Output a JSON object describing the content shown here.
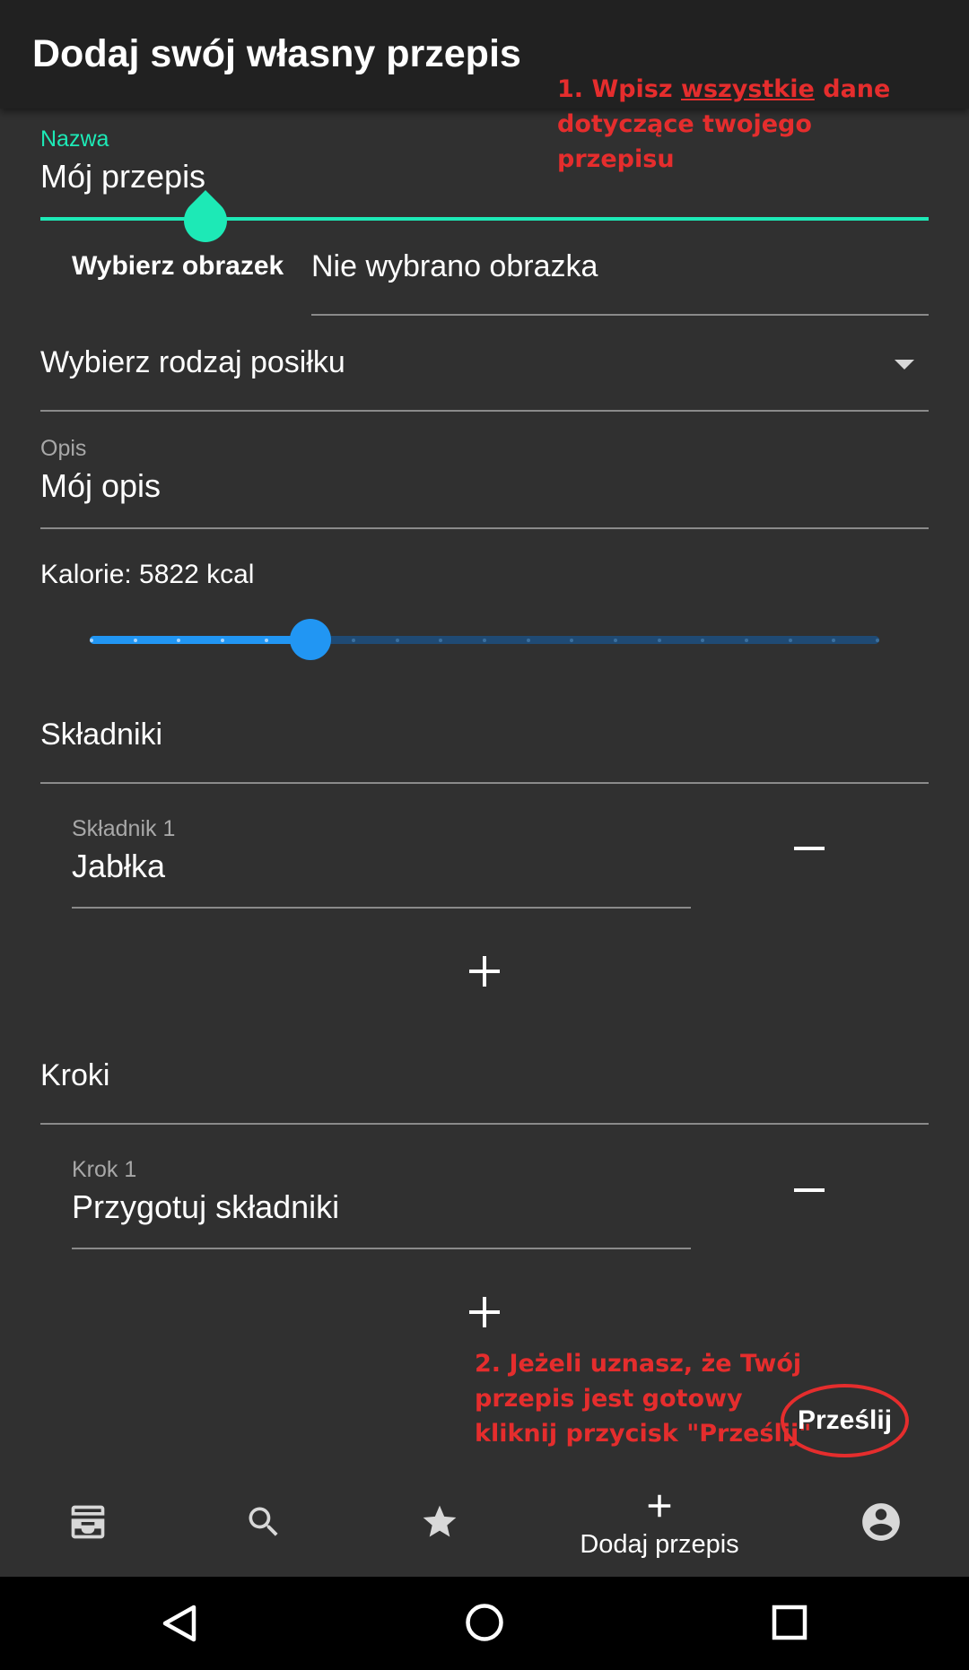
{
  "appbar": {
    "title": "Dodaj swój własny przepis"
  },
  "annotations": {
    "note1_prefix": "1. Wpisz ",
    "note1_emphasis": "wszystkie",
    "note1_suffix_line1": " dane",
    "note1_line2": "dotyczące twojego",
    "note1_line3": "przepisu",
    "note2_line1": "2. Jeżeli uznasz, że Twój",
    "note2_line2": "przepis jest gotowy",
    "note2_line3": "kliknij przycisk \"Prześlij\""
  },
  "name_field": {
    "label": "Nazwa",
    "value": "Mój przepis"
  },
  "image_picker": {
    "button_label": "Wybierz obrazek",
    "status": "Nie wybrano obrazka"
  },
  "meal_type": {
    "placeholder": "Wybierz rodzaj posiłku"
  },
  "description_field": {
    "label": "Opis",
    "value": "Mój opis"
  },
  "calories": {
    "label": "Kalorie: 5822 kcal",
    "slider_fraction": 0.28,
    "steps": 19,
    "active_color": "#2196f3",
    "inactive_color": "#1f4a74"
  },
  "ingredients": {
    "title": "Składniki",
    "items": [
      {
        "label": "Składnik 1",
        "value": "Jabłka"
      }
    ]
  },
  "steps": {
    "title": "Kroki",
    "items": [
      {
        "label": "Krok 1",
        "value": "Przygotuj składniki"
      }
    ]
  },
  "submit": {
    "label": "Prześlij"
  },
  "bottom_nav": {
    "items": [
      {
        "icon": "inbox-icon"
      },
      {
        "icon": "search-icon"
      },
      {
        "icon": "star-icon"
      },
      {
        "icon": "plus-icon",
        "label": "Dodaj przepis",
        "active": true
      },
      {
        "icon": "account-circle-icon"
      }
    ]
  },
  "system_nav": {
    "icons": [
      "back-icon",
      "home-icon",
      "recents-icon"
    ]
  },
  "colors": {
    "accent": "#1de9b6",
    "background": "#303030",
    "appbar": "#212121",
    "annotation": "#e52d2d"
  }
}
